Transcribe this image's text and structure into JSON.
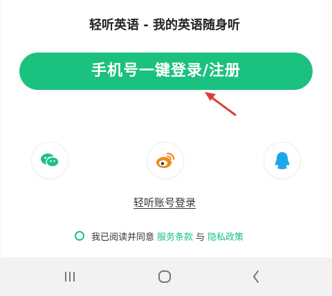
{
  "header": {
    "title": "轻听英语 - 我的英语随身听"
  },
  "login": {
    "phone_button_label": "手机号一键登录/注册",
    "account_login_label": "轻听账号登录"
  },
  "social": {
    "wechat": "wechat-icon",
    "weibo": "weibo-icon",
    "qq": "qq-icon"
  },
  "agreement": {
    "prefix": "我已阅读并同意",
    "terms_label": "服务条款",
    "and": "与",
    "privacy_label": "隐私政策"
  },
  "colors": {
    "accent": "#1bc17f",
    "weibo": "#f08a24",
    "qq": "#1ea7e8",
    "arrow": "#e33b3b"
  },
  "navbar": {
    "recents": "recents-icon",
    "home": "home-icon",
    "back": "back-icon"
  }
}
